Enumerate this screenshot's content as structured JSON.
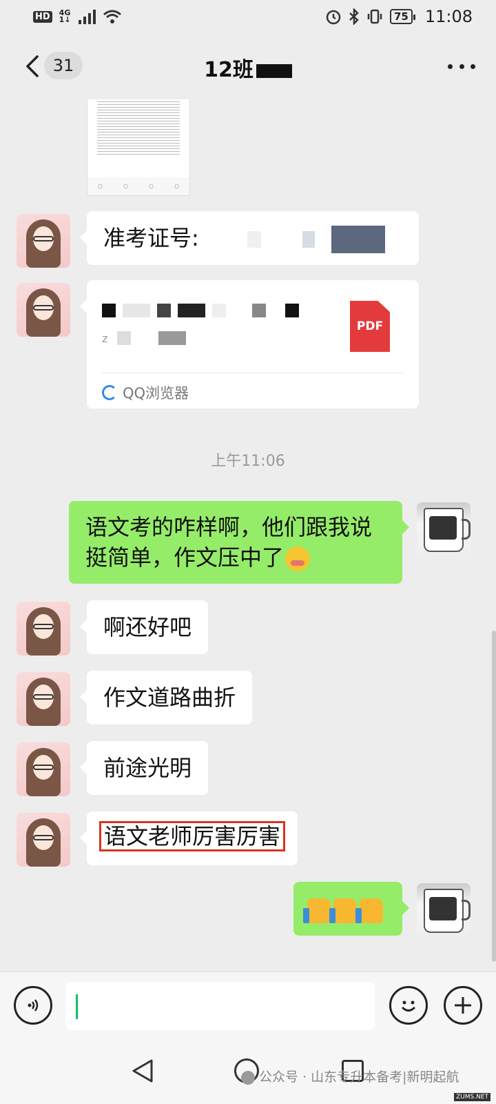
{
  "status_bar": {
    "hd": "HD",
    "network": "4G",
    "network_sub": "1↓",
    "battery": "75",
    "time": "11:08"
  },
  "header": {
    "unread_count": "31",
    "title": "12班"
  },
  "messages": {
    "exam_id_label": "准考证号:",
    "file_type": "PDF",
    "file_source": "QQ浏览器",
    "timestamp": "上午11:06",
    "msg_me_1": "语文考的咋样啊，他们跟我说挺简单，作文压中了",
    "msg_1": "啊还好吧",
    "msg_2": "作文道路曲折",
    "msg_3": "前途光明",
    "msg_4": "语文老师厉害厉害"
  },
  "watermark": "公众号 · 山东专升本备考|新明起航",
  "site_tag": "ZUMS.NET",
  "colors": {
    "sent_bubble": "#95ec69",
    "received_bubble": "#ffffff",
    "background": "#ededed",
    "highlight": "#d9331f",
    "pdf": "#e33b3b"
  }
}
